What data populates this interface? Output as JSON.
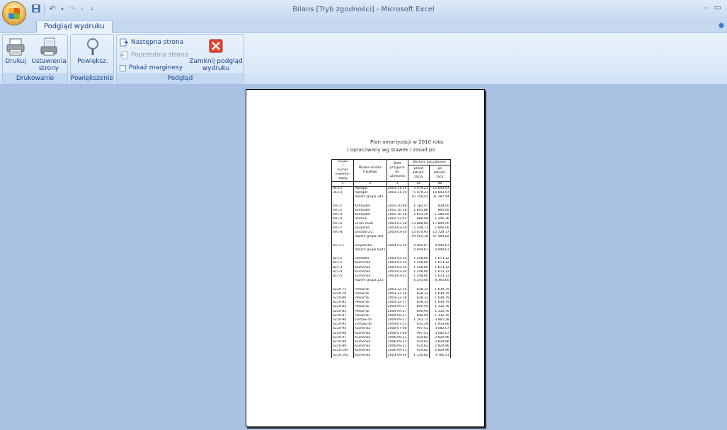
{
  "window": {
    "title": "Bilans  [Tryb zgodności] - Microsoft Excel",
    "controls": [
      "–",
      "▭"
    ]
  },
  "ribbon": {
    "active_tab": "Podgląd wydruku",
    "groups": {
      "drukowanie": {
        "label": "Drukowanie",
        "print": "Drukuj",
        "page_setup_1": "Ustawienia",
        "page_setup_2": "strony"
      },
      "powiekszenie": {
        "label": "Powiększenie",
        "zoom": "Powiększ."
      },
      "podglad": {
        "label": "Podgląd",
        "next_page": "Następna strona",
        "prev_page": "Poprzednia strona",
        "show_margins": "Pokaż marginesy",
        "close_1": "Zamknij podgląd",
        "close_2": "wydruku"
      }
    }
  },
  "document": {
    "title": "Plan amortyzacji w 2010 roku",
    "subtitle": "( opracowany wg stawek i zasad po",
    "headers": {
      "col1": [
        "Grupa",
        "i",
        "numer",
        "inwenta-",
        "rzowy"
      ],
      "col2": [
        "Nazwa środka",
        "trwałego"
      ],
      "col3": [
        "Data",
        "przyjęcia",
        "do",
        "używania"
      ],
      "col45": "Wartość początkowa",
      "col4": [
        "przed",
        "aktuali-",
        "zacją"
      ],
      "col5": [
        "po",
        "aktuali-",
        "zacji"
      ],
      "nums": [
        "1",
        "2",
        "3",
        "4a",
        "4b"
      ]
    },
    "rows": [
      [
        "343-2",
        "Agregat",
        "2003-11-29",
        "5 079,21",
        "15 643,97",
        ""
      ],
      [
        "343-3",
        "Agregat",
        "2003-11-29",
        "5 079,21",
        "15 643,97",
        ""
      ],
      [
        "",
        "Razem grupa 341",
        "",
        "10 158,42",
        "31 287,94",
        "b"
      ],
      [
        "",
        "",
        "",
        "",
        "",
        "gap"
      ],
      [
        "491-1",
        "Komputer",
        "2001-10-08",
        "1 182,47",
        "828,00",
        ""
      ],
      [
        "491-2",
        "Komputer",
        "2001-10-18",
        "1 841,80",
        "800,00",
        ""
      ],
      [
        "491-3",
        "Komputer",
        "2001-10-18",
        "2 843,29",
        "1 280,00",
        ""
      ],
      [
        "491-4",
        "Rzutnik",
        "2002-12-02",
        "888,04",
        "1 246,36",
        ""
      ],
      [
        "491-6",
        "Ekran multi",
        "2003-03-18",
        "23 888,69",
        "17 800,00",
        ""
      ],
      [
        "491-7",
        "Drukarka",
        "2003-03-18",
        "5 208,73",
        "7 800,00",
        ""
      ],
      [
        "491-8",
        "Zestaw urz.",
        "2003-03-30",
        "13 870,93",
        "15 728,17",
        ""
      ],
      [
        "",
        "Razem grupa 391",
        "",
        "49 491,18",
        "47 049,62",
        "b"
      ],
      [
        "",
        "",
        "",
        "",
        "",
        "gap"
      ],
      [
        "8371-1",
        "Zmywarka",
        "2004-03-19",
        "4 909,67",
        "4 909,67",
        ""
      ],
      [
        "",
        "Razem grupa 8241",
        "",
        "4 909,67",
        "4 909,67",
        "b"
      ],
      [
        "",
        "",
        "",
        "",
        "",
        "gap"
      ],
      [
        "821-1",
        "Lodówka",
        "2003-03-30",
        "1 248,60",
        "1 673,12",
        ""
      ],
      [
        "821-2",
        "Kuchenka",
        "2003-03-30",
        "1 248,60",
        "1 673,12",
        ""
      ],
      [
        "821-3",
        "Kuchenka",
        "2003-03-30",
        "1 248,60",
        "1 673,12",
        ""
      ],
      [
        "821-4",
        "Kuchenka",
        "2003-03-30",
        "1 248,60",
        "1 673,12",
        ""
      ],
      [
        "821-5",
        "Kuchenka",
        "2003-03-31",
        "1 248,60",
        "1 673,12",
        ""
      ],
      [
        "",
        "Razem grupa 221",
        "",
        "6 243,00",
        "8 365,60",
        "b"
      ],
      [
        "",
        "",
        "",
        "",
        "",
        "gap"
      ],
      [
        "6220-73",
        "Piekarnik",
        "2003-12-14",
        "838,33",
        "1 639,79",
        ""
      ],
      [
        "6220-79",
        "Piekarnik",
        "2003-12-18",
        "838,33",
        "1 639,79",
        ""
      ],
      [
        "6220-80",
        "Piekarnik",
        "2003-12-18",
        "838,33",
        "1 639,79",
        ""
      ],
      [
        "6220-82",
        "Piekarnik",
        "2003-12-17",
        "838,33",
        "1 639,79",
        ""
      ],
      [
        "6220-84",
        "Piekarnik",
        "2004-09-27",
        "890,94",
        "1 332,76",
        ""
      ],
      [
        "6220-85",
        "Piekarnik",
        "2004-09-27",
        "890,94",
        "1 332,76",
        ""
      ],
      [
        "6220-87",
        "Piekarnik",
        "2004-09-27",
        "890,94",
        "1 332,76",
        ""
      ],
      [
        "6220-90",
        "Zestaw do",
        "2004-09-27",
        "1 183,73",
        "3 861,28",
        ""
      ],
      [
        "6220-93",
        "Zestaw do",
        "2004-07-13",
        "831,29",
        "1 933,80",
        ""
      ],
      [
        "6220-94",
        "Kuchenka",
        "2006-07-08",
        "997,41",
        "3 082,07",
        ""
      ],
      [
        "6220-96",
        "Kuchenka",
        "2006-07-08",
        "997,41",
        "3 082,07",
        ""
      ],
      [
        "6220-97",
        "Kuchenka",
        "2006-09-21",
        "924,82",
        "2 829,96",
        ""
      ],
      [
        "6220-98",
        "Kuchenka",
        "2006-09-21",
        "924,82",
        "2 829,96",
        ""
      ],
      [
        "6220-99",
        "Kuchenka",
        "2006-09-21",
        "924,82",
        "2 829,96",
        ""
      ],
      [
        "6220-100",
        "Kuchenka",
        "2006-09-21",
        "924,82",
        "2 829,96",
        ""
      ],
      [
        "6220-102",
        "Kuchenka",
        "2003-09-30",
        "1 230,82",
        "3 766,31",
        ""
      ]
    ]
  }
}
